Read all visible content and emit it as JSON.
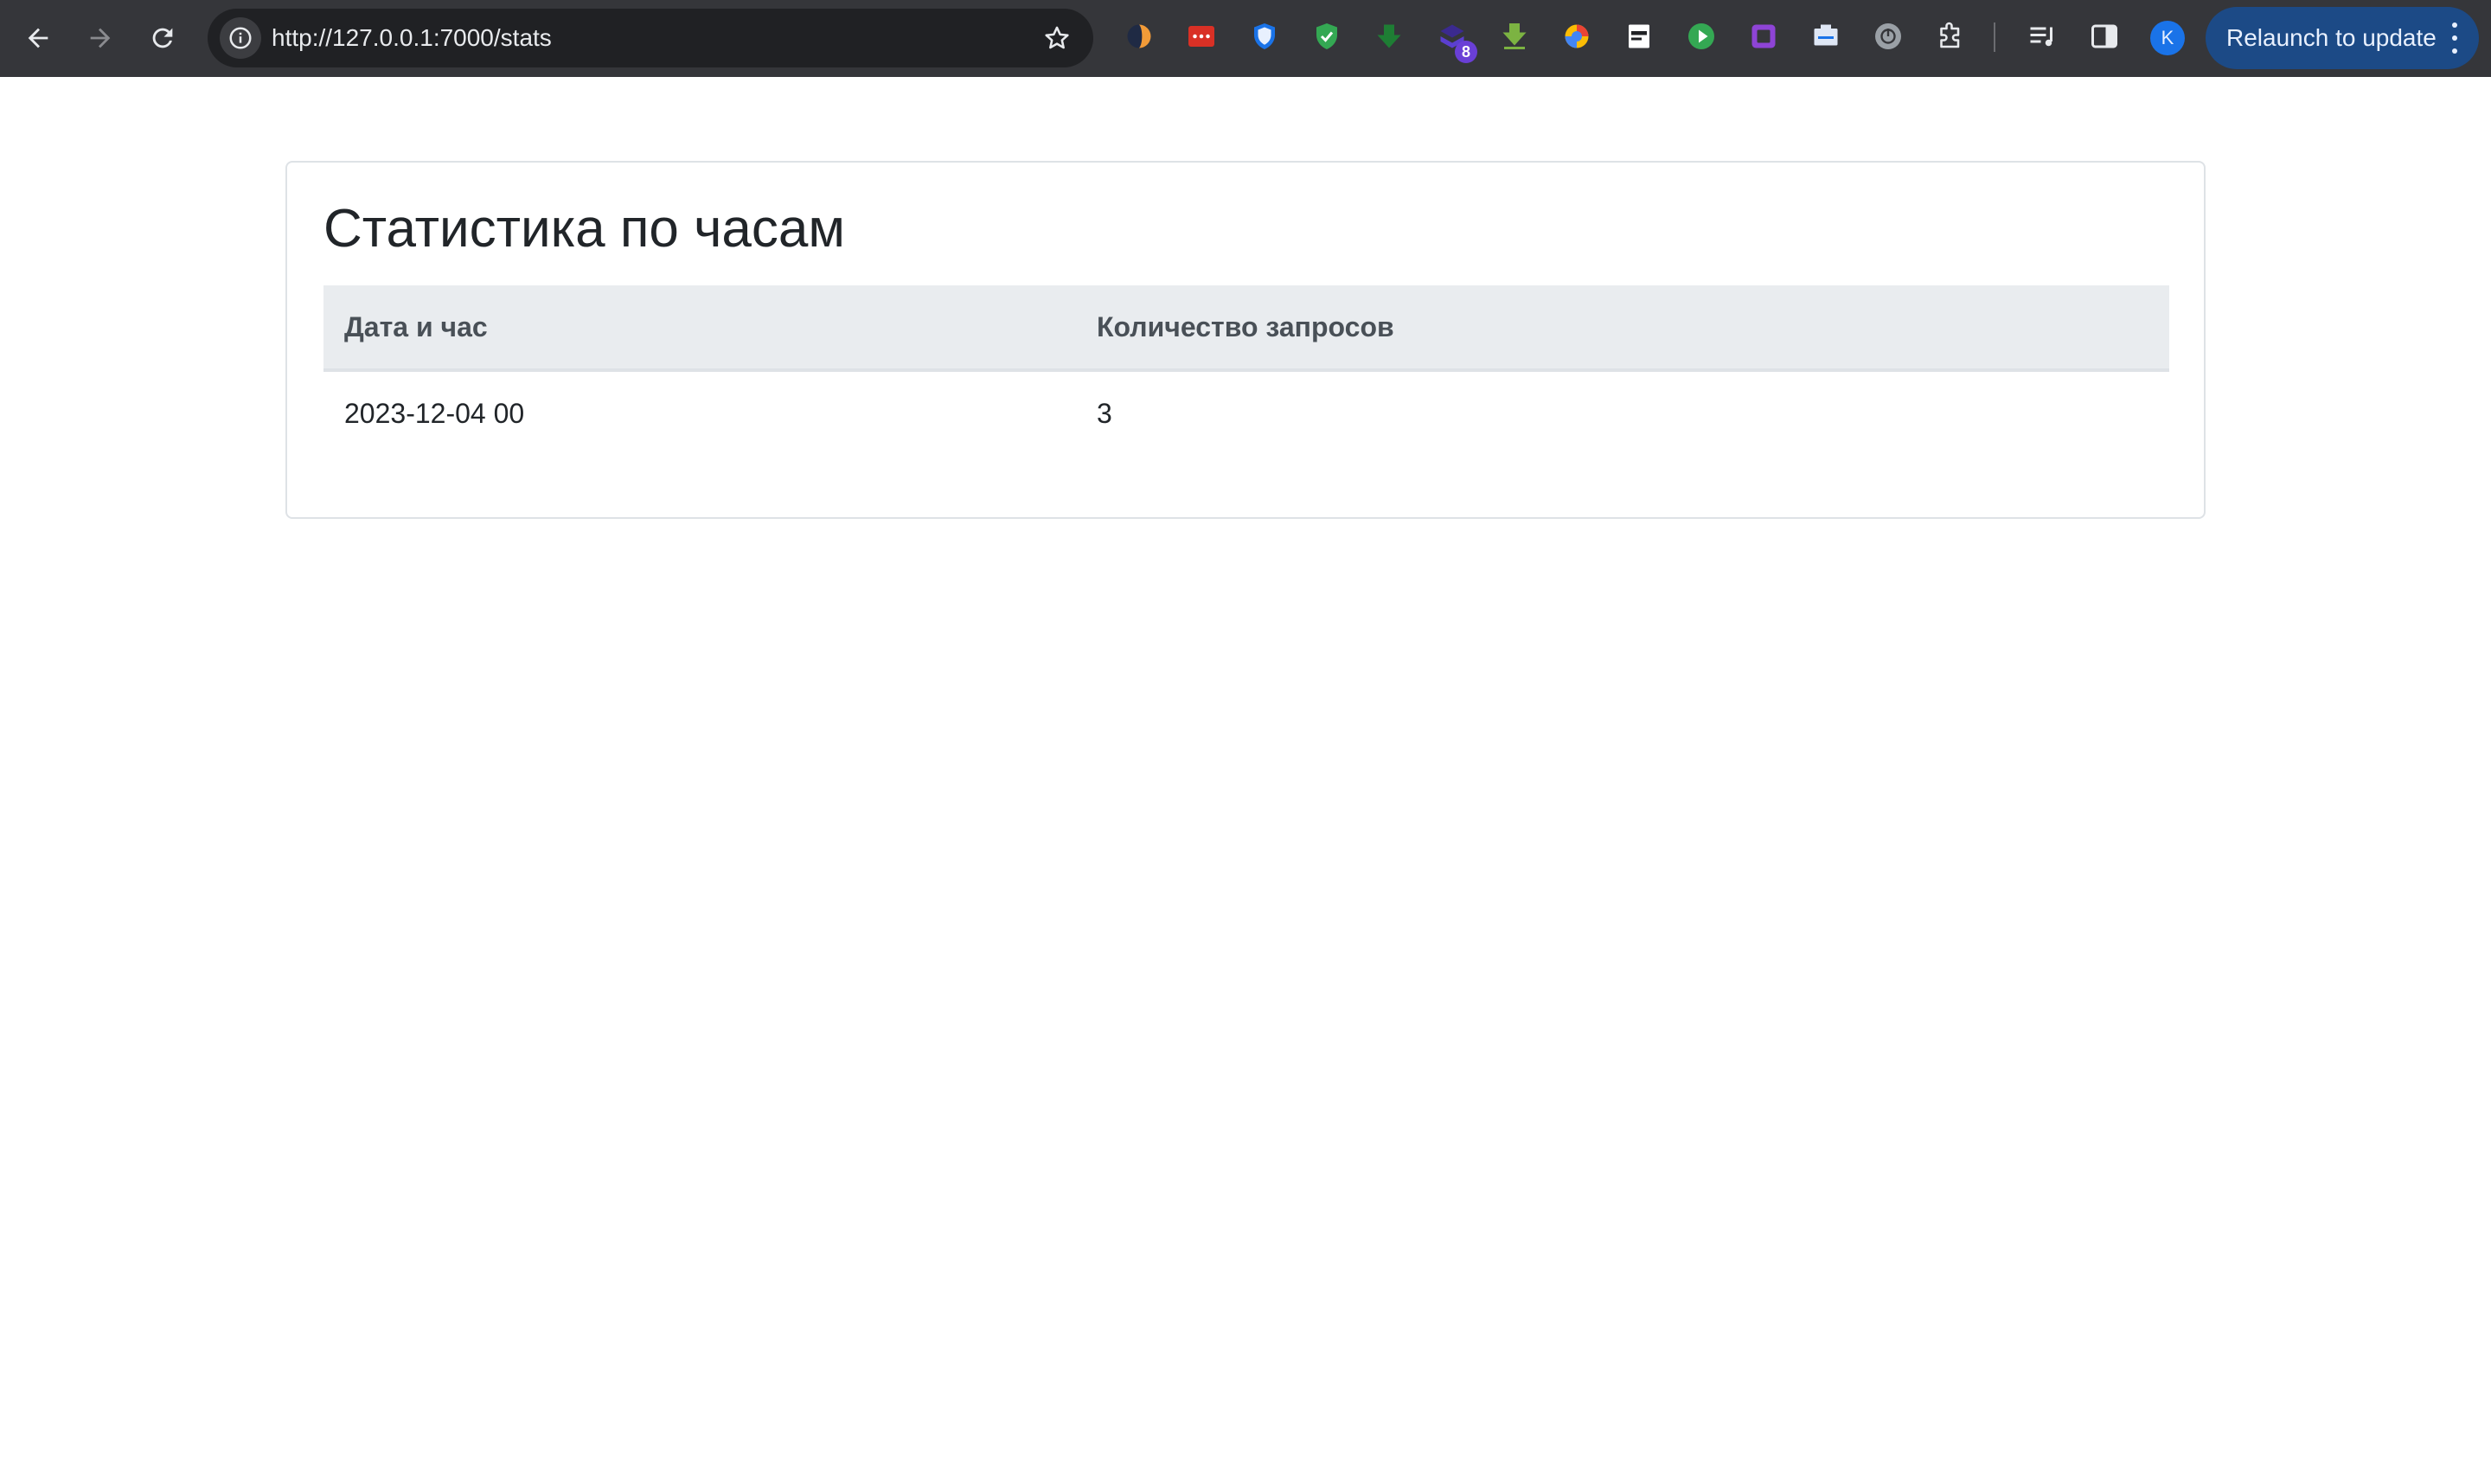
{
  "browser": {
    "url": "http://127.0.0.1:7000/stats",
    "extensions": [
      {
        "name": "orange-circle-extension-icon"
      },
      {
        "name": "password-manager-extension-icon"
      },
      {
        "name": "shield-extension-icon"
      },
      {
        "name": "green-shield-extension-icon"
      },
      {
        "name": "download-arrow-extension-icon"
      },
      {
        "name": "purple-extension-icon",
        "badge": "8"
      },
      {
        "name": "green-download-extension-icon"
      },
      {
        "name": "color-circle-extension-icon"
      },
      {
        "name": "document-extension-icon"
      },
      {
        "name": "play-extension-icon"
      },
      {
        "name": "purple-square-extension-icon"
      },
      {
        "name": "card-extension-icon"
      },
      {
        "name": "power-extension-icon"
      },
      {
        "name": "puzzle-icon"
      }
    ],
    "avatar_initial": "K",
    "relaunch_label": "Relaunch to update",
    "colors": {
      "toolbar": "#35363a",
      "omnibox": "#202124",
      "relaunch_button": "#1c4a86",
      "avatar": "#1a73e8"
    }
  },
  "page": {
    "title": "Статистика по часам",
    "table": {
      "headers": [
        "Дата и час",
        "Количество запросов"
      ],
      "rows": [
        [
          "2023-12-04 00",
          "3"
        ]
      ]
    },
    "colors": {
      "header_background": "#e9ecef",
      "border": "#dee2e6",
      "text": "#212529"
    }
  }
}
